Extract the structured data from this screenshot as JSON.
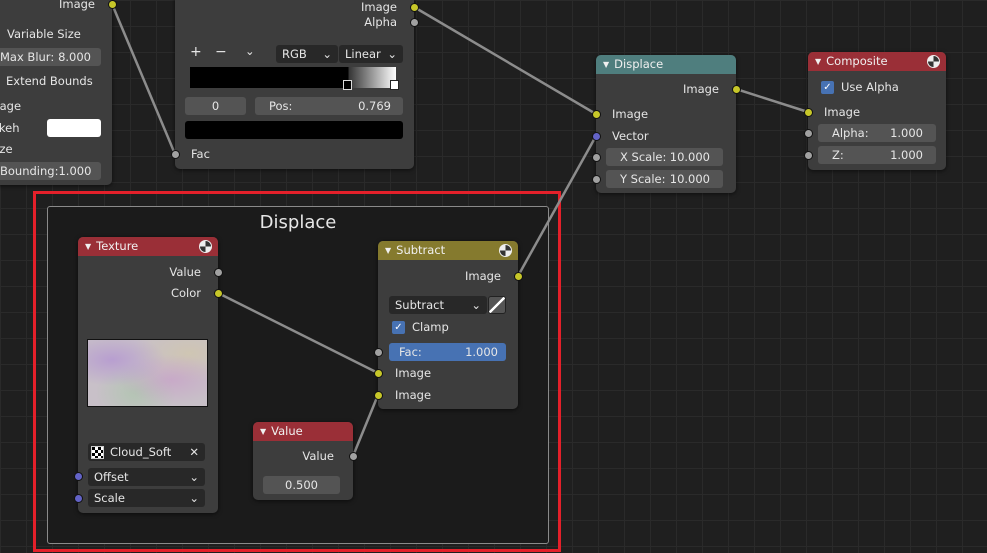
{
  "bokeh_node": {
    "image_out": "Image",
    "variable_size": "Variable Size",
    "max_blur_label": "Max Blur:",
    "max_blur_value": "8.000",
    "extend_bounds": "Extend Bounds",
    "image_in": "Image",
    "bokeh": "Bokeh",
    "size": "Size",
    "bounding_label": "Bounding:",
    "bounding_value": "1.000"
  },
  "ramp_node": {
    "image_out": "Image",
    "alpha_out": "Alpha",
    "add": "+",
    "remove": "−",
    "menu": "⌄",
    "color_mode": "RGB",
    "interpolation": "Linear",
    "stop_index": "0",
    "pos_label": "Pos:",
    "pos_value": "0.769",
    "fac_in": "Fac"
  },
  "displace_node": {
    "title": "Displace",
    "image_out": "Image",
    "image_in": "Image",
    "vector_in": "Vector",
    "x_scale_label": "X Scale:",
    "x_scale_value": "10.000",
    "y_scale_label": "Y Scale:",
    "y_scale_value": "10.000",
    "header_color": "#4f7e7e"
  },
  "composite_node": {
    "title": "Composite",
    "use_alpha": "Use Alpha",
    "use_alpha_checked": true,
    "image_in": "Image",
    "alpha_label": "Alpha:",
    "alpha_value": "1.000",
    "z_label": "Z:",
    "z_value": "1.000",
    "header_color": "#9a2f37"
  },
  "frame": {
    "label": "Displace",
    "highlight_color": "#e4202a"
  },
  "texture_node": {
    "title": "Texture",
    "value_out": "Value",
    "color_out": "Color",
    "texture_name": "Cloud_Soft",
    "offset": "Offset",
    "scale": "Scale"
  },
  "subtract_node": {
    "title": "Subtract",
    "image_out": "Image",
    "blend_mode": "Subtract",
    "clamp": "Clamp",
    "clamp_checked": true,
    "fac_label": "Fac:",
    "fac_value": "1.000",
    "image_in_1": "Image",
    "image_in_2": "Image",
    "header_color": "#857a2e"
  },
  "value_node": {
    "title": "Value",
    "value_out": "Value",
    "value": "0.500"
  }
}
